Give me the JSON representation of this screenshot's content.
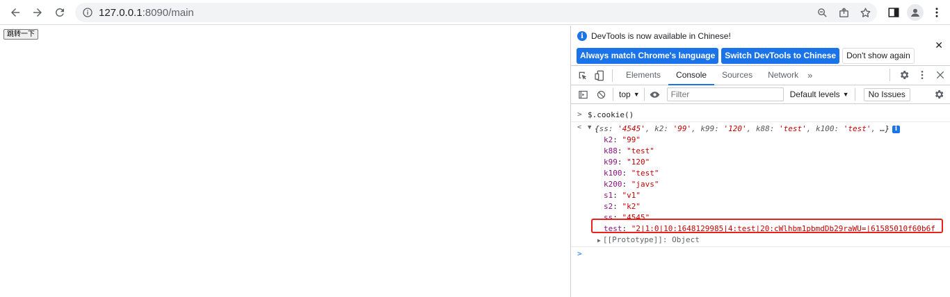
{
  "browser": {
    "url_host": "127.0.0.1",
    "url_path": ":8090/main"
  },
  "page": {
    "button_label": "跳转一下"
  },
  "devtools": {
    "infobar": {
      "message": "DevTools is now available in Chinese!",
      "btn_match": "Always match Chrome's language",
      "btn_switch": "Switch DevTools to Chinese",
      "btn_dismiss": "Don't show again",
      "close": "✕"
    },
    "tabs": [
      "Elements",
      "Console",
      "Sources",
      "Network"
    ],
    "active_tab": "Console",
    "more_tabs": "»",
    "context": "top",
    "filter_placeholder": "Filter",
    "levels": "Default levels",
    "issues": "No Issues",
    "console": {
      "input_prompt": ">",
      "command": "$.cookie()",
      "result_prompt": "<",
      "summary": {
        "open": "{",
        "pairs": [
          {
            "k": "ss",
            "v": "'4545'"
          },
          {
            "k": "k2",
            "v": "'99'"
          },
          {
            "k": "k99",
            "v": "'120'"
          },
          {
            "k": "k88",
            "v": "'test'"
          },
          {
            "k": "k100",
            "v": "'test'"
          }
        ],
        "tail": "…}"
      },
      "properties": [
        {
          "key": "k2",
          "value": "\"99\""
        },
        {
          "key": "k88",
          "value": "\"test\""
        },
        {
          "key": "k99",
          "value": "\"120\""
        },
        {
          "key": "k100",
          "value": "\"test\""
        },
        {
          "key": "k200",
          "value": "\"javs\""
        },
        {
          "key": "s1",
          "value": "\"v1\""
        },
        {
          "key": "s2",
          "value": "\"k2\""
        },
        {
          "key": "ss",
          "value": "\"4545\""
        },
        {
          "key": "test",
          "value": "\"2|1:0|10:1648129985|4:test|20:cWlhbm1pbmdDb29raWU=|61585010f60b6f"
        }
      ],
      "prototype": "[[Prototype]]: Object",
      "empty_prompt": ">"
    },
    "colors": {
      "accent": "#1a73e8",
      "highlight": "#e8211b",
      "key": "#881280",
      "string": "#c80000"
    }
  }
}
